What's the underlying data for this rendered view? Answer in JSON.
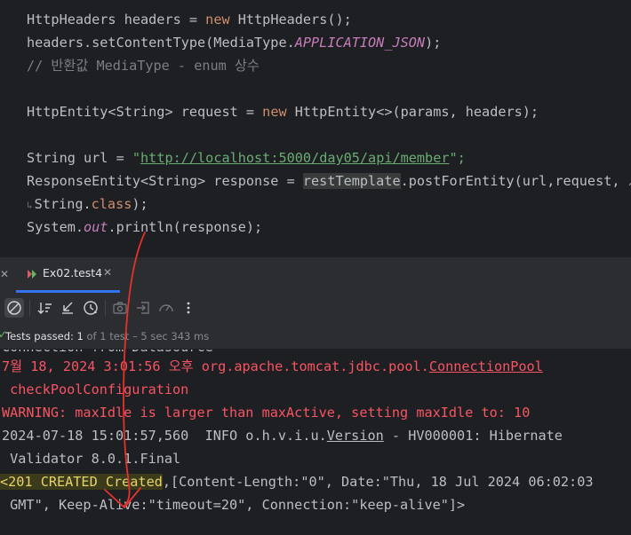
{
  "editor": {
    "lines": [
      {
        "a": "HttpHeaders headers = ",
        "b": "new",
        "c": " HttpHeaders();"
      },
      {
        "a": "headers.setContentType(MediaType.",
        "b": "APPLICATION_JSON",
        "c": ");"
      },
      {
        "a": "// 반환값 MediaType - enum 상수"
      },
      {
        "a": "HttpEntity<String> request = ",
        "b": "new",
        "c": " HttpEntity<>(params, headers);"
      },
      {
        "a": "String url = ",
        "b": "\"",
        "c": "http://localhost:5000/day05/api/member",
        "d": "\";"
      },
      {
        "a": "ResponseEntity<String> response = ",
        "b": "restTemplate",
        "c": ".postForEntity(url,request,",
        "d": "↗"
      },
      {
        "a": "String.",
        "b": "class",
        "c": ");"
      },
      {
        "a": "System.",
        "b": "out",
        "c": ".println(response);"
      }
    ]
  },
  "tabs": {
    "active_label": "Ex02.test4"
  },
  "status": {
    "passed_label": "Tests passed:",
    "passed_count": "1",
    "detail": "of 1 test – 5 sec 343 ms"
  },
  "console": {
    "l0": "Connection from Datasource",
    "l1_a": "7월 18, 2024 3:01:56 오후 org.apache.tomcat.jdbc.pool.",
    "l1_b": "ConnectionPool",
    "l2": " checkPoolConfiguration",
    "l3": "WARNING: maxIdle is larger than maxActive, setting maxIdle to: 10",
    "l4_a": "2024-07-18 15:01:57,560  INFO o.h.v.i.u.",
    "l4_b": "Version",
    "l4_c": " - HV000001: Hibernate",
    "l5": " Validator 8.0.1.Final",
    "l6_a": "<201 CREATED Created",
    "l6_b": ",[Content-Length:\"0\", Date:\"Thu, 18 Jul 2024 06:02:03",
    "l7": " GMT\", Keep-Alive:\"timeout=20\", Connection:\"keep-alive\"]>"
  },
  "colors": {
    "accent": "#3574f0",
    "success": "#5fb865",
    "error": "#f75464",
    "annotation": "#e5322d"
  }
}
